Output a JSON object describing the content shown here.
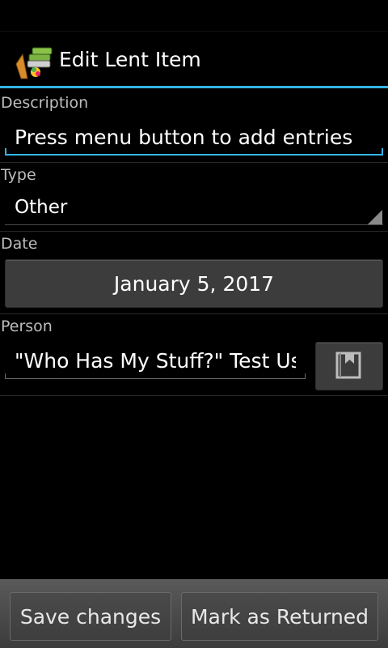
{
  "app": {
    "title": "Edit Lent Item",
    "icon": "books-app-icon"
  },
  "form": {
    "description": {
      "label": "Description",
      "value": "Press menu button to add entries"
    },
    "type": {
      "label": "Type",
      "selected": "Other"
    },
    "date": {
      "label": "Date",
      "value": "January 5, 2017"
    },
    "person": {
      "label": "Person",
      "value": "\"Who Has My Stuff?\" Test User",
      "contact_icon": "contact-picker-icon"
    }
  },
  "footer": {
    "save_label": "Save changes",
    "return_label": "Mark as Returned"
  },
  "colors": {
    "accent": "#33b5e5",
    "background": "#000000",
    "button": "#3c3c3c"
  }
}
